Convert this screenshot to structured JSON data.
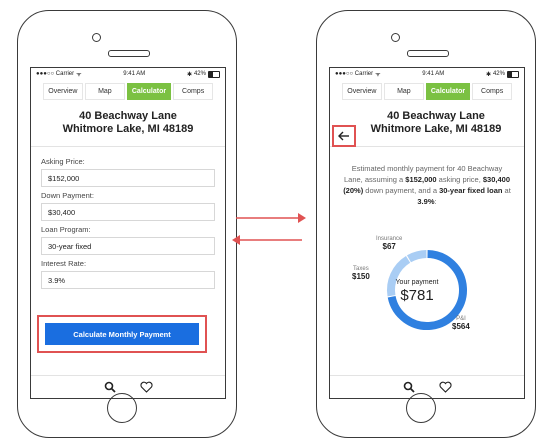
{
  "status": {
    "carrier": "●●●○○ Carrier",
    "time": "9:41 AM",
    "battery": "42%"
  },
  "tabs": [
    "Overview",
    "Map",
    "Calculator",
    "Comps"
  ],
  "address": {
    "line1": "40 Beachway Lane",
    "line2": "Whitmore Lake, MI 48189"
  },
  "form": {
    "asking_label": "Asking Price:",
    "asking_value": "$152,000",
    "down_label": "Down Payment:",
    "down_value": "$30,400",
    "loan_label": "Loan Program:",
    "loan_value": "30-year fixed",
    "rate_label": "Interest Rate:",
    "rate_value": "3.9%",
    "calc_button": "Calculate Monthly Payment"
  },
  "result": {
    "summary_pre": "Estimated monthly payment for 40 Beachway Lane, assuming a ",
    "price": "$152,000",
    "summary_mid": " asking price, ",
    "down": "$30,400 (20%)",
    "summary_mid2": " down payment, and a ",
    "loan": "30-year fixed loan",
    "summary_mid3": " at ",
    "rate": "3.9%",
    "summary_end": ":",
    "your_payment_label": "Your payment",
    "your_payment_value": "$781",
    "insurance_label": "Insurance",
    "insurance_value": "$67",
    "taxes_label": "Taxes",
    "taxes_value": "$150",
    "pi_label": "P&I",
    "pi_value": "$564"
  },
  "chart_data": {
    "type": "pie",
    "categories": [
      "Insurance",
      "Taxes",
      "P&I"
    ],
    "values": [
      67,
      150,
      564
    ]
  },
  "colors": {
    "accent": "#7bc142",
    "button": "#1a6ee0",
    "highlight": "#e05252",
    "donut_main": "#2f80e0",
    "donut_light": "#a9cdf4"
  }
}
